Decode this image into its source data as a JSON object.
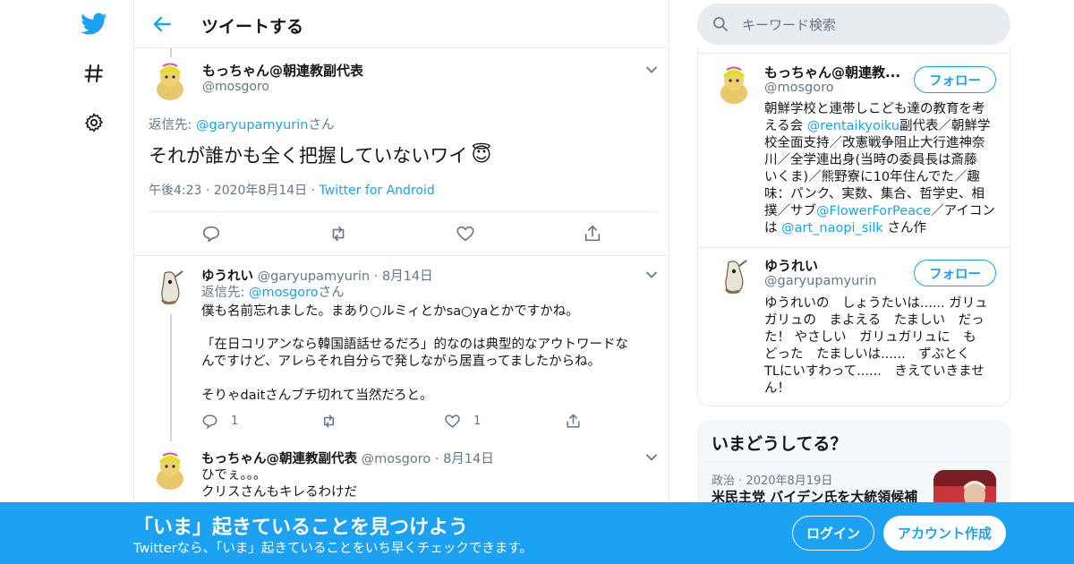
{
  "colors": {
    "accent": "#1da1f2",
    "text": "#14171a",
    "muted": "#657786",
    "border": "#e6ecf0"
  },
  "nav": {
    "icons": [
      "twitter-bird-icon",
      "hashtag-icon",
      "gear-icon"
    ]
  },
  "header": {
    "title": "ツイートする"
  },
  "focus_tweet": {
    "name": "もっちゃん@朝連教副代表",
    "handle": "@mosgoro",
    "reply_prefix": "返信先: ",
    "reply_to": "@garyupamyurin",
    "reply_suffix": "さん",
    "text": "それが誰かも全く把握していないワイ",
    "emoji": "😇",
    "time": "午後4:23",
    "date": "2020年8月14日",
    "source": "Twitter for Android",
    "sep": "·"
  },
  "replies": [
    {
      "name": "ゆうれい",
      "handle": "@garyupamyurin",
      "date": "8月14日",
      "reply_prefix": "返信先: ",
      "reply_to": "@mosgoro",
      "reply_suffix": "さん",
      "line1": "僕も名前忘れました。まあり○ルミィとかsa○yaとかですかね。",
      "line2a": "「在日コリアンなら韓国語話せるだろ」的なのは典型的なアウトワードな",
      "line2b": "んですけど、アレらそれ自分らで発しながら居直ってましたからね。",
      "line3": "そりゃdaitさんブチ切れて当然だろと。",
      "reply_count": "1",
      "like_count": "1"
    },
    {
      "name": "もっちゃん@朝連教副代表",
      "handle": "@mosgoro",
      "date": "8月14日",
      "line1": "ひでぇ。。。",
      "line2": "クリスさんもキレるわけだ"
    }
  ],
  "search": {
    "placeholder": "キーワード検索"
  },
  "users": [
    {
      "name": "もっちゃん@朝連教...",
      "handle": "@mosgoro",
      "follow": "フォロー",
      "bio_lines": [
        "朝鮮学校と連帯しこども達の教育を考",
        "える会 ",
        "副代表／朝鮮学",
        "校全面支持／改憲戦争阻止大行進神奈",
        "川／全学連出身(当時の委員長は斎藤",
        "いくま)／熊野寮に10年住んでた／趣",
        "味：パンク、実数、集合、哲学史、相",
        "撲／サブ",
        "／アイコン",
        "は ",
        " さん作"
      ],
      "mentions": [
        "@rentaikyoiku",
        "@FlowerForPeace",
        "@art_naopi_silk"
      ]
    },
    {
      "name": "ゆうれい",
      "handle": "@garyupamyurin",
      "follow": "フォロー",
      "bio_lines": [
        "ゆうれいの　しょうたいは...... ガリュ",
        "ガリュの　まよえる　たましい　だっ",
        "た！ やさしい　ガリュガリュに　も",
        "どった　たましいは......　ずぶとく",
        "TLにいすわって......　きえていきませ",
        "ん！"
      ]
    }
  ],
  "trends": {
    "title": "いまどうしてる？",
    "category": "政治",
    "date": "2020年8月19日",
    "headline": "米民主党 バイデン氏を大統領候補"
  },
  "bottom_bar": {
    "title": "「いま」起きていることを見つけよう",
    "subtitle": "Twitterなら、「いま」起きていることをいち早くチェックできます。",
    "login": "ログイン",
    "signup": "アカウント作成"
  }
}
